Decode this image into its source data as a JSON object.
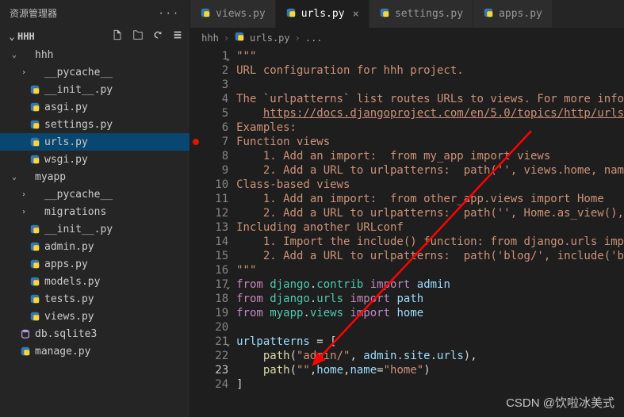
{
  "sidebar": {
    "title": "资源管理器",
    "more": "···",
    "project": "HHH",
    "tree": [
      {
        "depth": 0,
        "chevron": "down",
        "type": "folder",
        "label": "hhh"
      },
      {
        "depth": 1,
        "chevron": "right",
        "type": "folder",
        "label": "__pycache__"
      },
      {
        "depth": 1,
        "chevron": "none",
        "type": "py",
        "label": "__init__.py"
      },
      {
        "depth": 1,
        "chevron": "none",
        "type": "py",
        "label": "asgi.py"
      },
      {
        "depth": 1,
        "chevron": "none",
        "type": "py",
        "label": "settings.py"
      },
      {
        "depth": 1,
        "chevron": "none",
        "type": "py",
        "label": "urls.py",
        "selected": true
      },
      {
        "depth": 1,
        "chevron": "none",
        "type": "py",
        "label": "wsgi.py"
      },
      {
        "depth": 0,
        "chevron": "down",
        "type": "folder",
        "label": "myapp"
      },
      {
        "depth": 1,
        "chevron": "right",
        "type": "folder",
        "label": "__pycache__"
      },
      {
        "depth": 1,
        "chevron": "right",
        "type": "folder",
        "label": "migrations"
      },
      {
        "depth": 1,
        "chevron": "none",
        "type": "py",
        "label": "__init__.py"
      },
      {
        "depth": 1,
        "chevron": "none",
        "type": "py",
        "label": "admin.py"
      },
      {
        "depth": 1,
        "chevron": "none",
        "type": "py",
        "label": "apps.py"
      },
      {
        "depth": 1,
        "chevron": "none",
        "type": "py",
        "label": "models.py"
      },
      {
        "depth": 1,
        "chevron": "none",
        "type": "py",
        "label": "tests.py"
      },
      {
        "depth": 1,
        "chevron": "none",
        "type": "py",
        "label": "views.py"
      },
      {
        "depth": 0,
        "chevron": "none",
        "type": "db",
        "label": "db.sqlite3"
      },
      {
        "depth": 0,
        "chevron": "none",
        "type": "py",
        "label": "manage.py"
      }
    ]
  },
  "tabs": [
    {
      "label": "views.py",
      "active": false
    },
    {
      "label": "urls.py",
      "active": true,
      "close": true
    },
    {
      "label": "settings.py",
      "active": false
    },
    {
      "label": "apps.py",
      "active": false
    }
  ],
  "breadcrumb": [
    "hhh",
    "urls.py",
    "..."
  ],
  "code_lines": [
    {
      "n": 1,
      "fold": "down",
      "html": "<span class='tok-str'>\"\"\"</span>"
    },
    {
      "n": 2,
      "html": "<span class='tok-str'>URL configuration for hhh project.</span>"
    },
    {
      "n": 3,
      "html": ""
    },
    {
      "n": 4,
      "html": "<span class='tok-str'>The `urlpatterns` list routes URLs to views. For more info</span>"
    },
    {
      "n": 5,
      "html": "    <span class='tok-link'>https://docs.djangoproject.com/en/5.0/topics/http/urls</span>"
    },
    {
      "n": 6,
      "html": "<span class='tok-str'>Examples:</span>"
    },
    {
      "n": 7,
      "bp": true,
      "html": "<span class='tok-str'>Function views</span>"
    },
    {
      "n": 8,
      "html": "<span class='tok-str'>    1. Add an import:  from my_app import views</span>"
    },
    {
      "n": 9,
      "html": "<span class='tok-str'>    2. Add a URL to urlpatterns:  path('', views.home, nam</span>"
    },
    {
      "n": 10,
      "html": "<span class='tok-str'>Class-based views</span>"
    },
    {
      "n": 11,
      "html": "<span class='tok-str'>    1. Add an import:  from other_app.views import Home</span>"
    },
    {
      "n": 12,
      "html": "<span class='tok-str'>    2. Add a URL to urlpatterns:  path('', Home.as_view(),</span>"
    },
    {
      "n": 13,
      "html": "<span class='tok-str'>Including another URLconf</span>"
    },
    {
      "n": 14,
      "html": "<span class='tok-str'>    1. Import the include() function: from django.urls imp</span>"
    },
    {
      "n": 15,
      "html": "<span class='tok-str'>    2. Add a URL to urlpatterns:  path('blog/', include('b</span>"
    },
    {
      "n": 16,
      "html": "<span class='tok-str'>\"\"\"</span>"
    },
    {
      "n": 17,
      "fold": "down",
      "html": "<span class='tok-kw'>from</span> <span class='tok-mod'>django</span><span class='tok-punc'>.</span><span class='tok-mod'>contrib</span> <span class='tok-kw'>import</span> <span class='tok-var'>admin</span>"
    },
    {
      "n": 18,
      "html": "<span class='tok-kw'>from</span> <span class='tok-mod'>django</span><span class='tok-punc'>.</span><span class='tok-mod'>urls</span> <span class='tok-kw'>import</span> <span class='tok-var'>path</span>"
    },
    {
      "n": 19,
      "html": "<span class='tok-kw'>from</span> <span class='tok-mod'>myapp</span><span class='tok-punc'>.</span><span class='tok-mod'>views</span> <span class='tok-kw'>import</span> <span class='tok-var'>home</span>"
    },
    {
      "n": 20,
      "html": ""
    },
    {
      "n": 21,
      "fold": "down",
      "html": "<span class='tok-var'>urlpatterns</span> <span class='tok-punc'>= [</span>"
    },
    {
      "n": 22,
      "html": "    <span class='tok-fn'>path</span><span class='tok-punc'>(</span><span class='tok-str'>\"admin/\"</span><span class='tok-punc'>, </span><span class='tok-var'>admin</span><span class='tok-punc'>.</span><span class='tok-var'>site</span><span class='tok-punc'>.</span><span class='tok-var'>urls</span><span class='tok-punc'>),</span>"
    },
    {
      "n": 23,
      "active": true,
      "html": "    <span class='tok-fn'>path</span><span class='tok-punc'>(</span><span class='tok-str'>\"\"</span><span class='tok-punc'>,</span><span class='tok-var'>home</span><span class='tok-punc'>,</span><span class='tok-var'>name</span><span class='tok-punc'>=</span><span class='tok-str'>\"home\"</span><span class='tok-punc'>)</span>"
    },
    {
      "n": 24,
      "html": "<span class='tok-punc'>]</span>"
    }
  ],
  "watermark": "CSDN @饮啦冰美式",
  "icons": {
    "py_color": "#3776ab",
    "db_color": "#b39ddb"
  }
}
